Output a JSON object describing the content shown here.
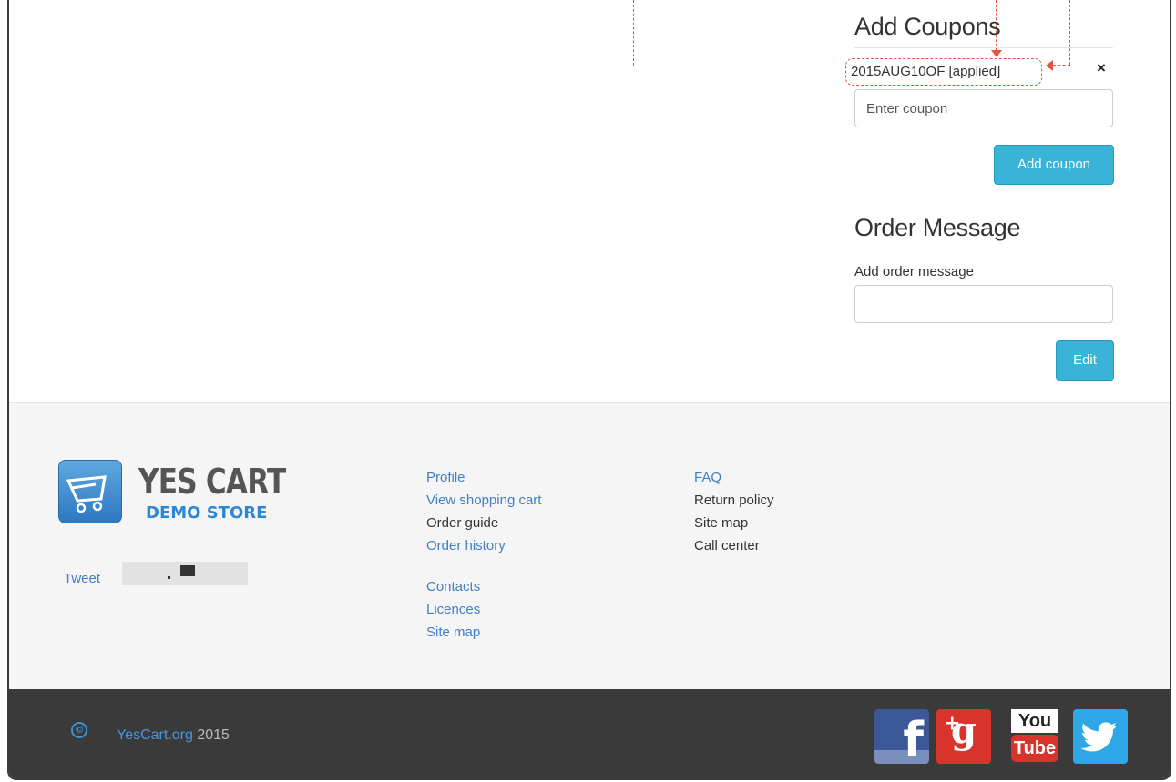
{
  "coupons": {
    "heading": "Add Coupons",
    "applied_code": "2015AUG10OF [applied]",
    "remove_icon": "×",
    "input_placeholder": "Enter coupon",
    "add_button": "Add coupon"
  },
  "order_message": {
    "heading": "Order Message",
    "label": "Add order message",
    "edit_button": "Edit"
  },
  "footer": {
    "logo_title": "YES CART",
    "logo_subtitle": "DEMO STORE",
    "tweet": "Tweet",
    "col1": [
      "Profile",
      "View shopping cart",
      "Order guide",
      "Order history"
    ],
    "col1b": [
      "Contacts",
      "Licences",
      "Site map"
    ],
    "col2": [
      "FAQ",
      "Return policy",
      "Site map",
      "Call center"
    ]
  },
  "bottom": {
    "copyright_link": "YesCart.org",
    "year": "2015",
    "social": {
      "facebook_letter": "f",
      "gplus": "g",
      "gplus_sup": "+",
      "youtube_top": "You",
      "youtube_bottom": "Tube",
      "twitter_glyph": "🐦"
    }
  },
  "colors": {
    "accent": "#39b3d7",
    "link": "#3f7fc5",
    "annotation": "#e0553f",
    "footer_bottom": "#3a3a3a"
  }
}
